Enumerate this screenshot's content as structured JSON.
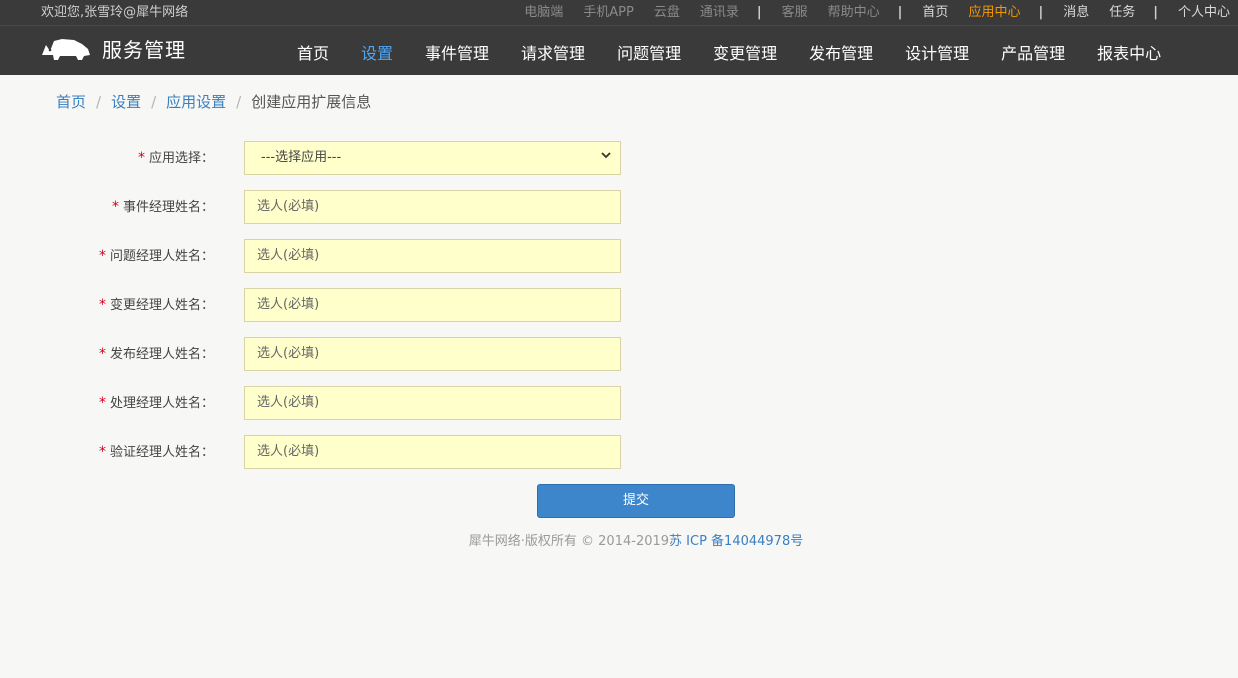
{
  "topbar": {
    "welcome": "欢迎您,张雪玲@犀牛网络",
    "links_dim": [
      "电脑端",
      "手机APP",
      "云盘",
      "通讯录"
    ],
    "links_help": [
      "客服",
      "帮助中心"
    ],
    "home": "首页",
    "app_center": "应用中心",
    "messages": "消息",
    "tasks": "任务",
    "personal_center": "个人中心",
    "separator": "|",
    "active_color": "#f39800"
  },
  "brand": {
    "logo_icon": "rhino-icon",
    "title": "服务管理"
  },
  "nav": {
    "items": [
      "首页",
      "设置",
      "事件管理",
      "请求管理",
      "问题管理",
      "变更管理",
      "发布管理",
      "设计管理",
      "产品管理",
      "报表中心"
    ],
    "active": "设置",
    "active_color": "#4fa6f0"
  },
  "breadcrumb": {
    "items": [
      "首页",
      "设置",
      "应用设置"
    ],
    "current": "创建应用扩展信息",
    "separator": "/"
  },
  "form": {
    "required_mark": "*",
    "app_select": {
      "label": "应用选择：",
      "value": "---选择应用---"
    },
    "fields": [
      {
        "label": "事件经理姓名：",
        "placeholder": "选人(必填)"
      },
      {
        "label": "问题经理人姓名：",
        "placeholder": "选人(必填)"
      },
      {
        "label": "变更经理人姓名：",
        "placeholder": "选人(必填)"
      },
      {
        "label": "发布经理人姓名：",
        "placeholder": "选人(必填)"
      },
      {
        "label": "处理经理人姓名：",
        "placeholder": "选人(必填)"
      },
      {
        "label": "验证经理人姓名：",
        "placeholder": "选人(必填)"
      }
    ],
    "field_background": "#ffffcc",
    "submit_label": "提交",
    "submit_color": "#3d86cc"
  },
  "footer": {
    "copyright": "犀牛网络·版权所有 © 2014-2019",
    "icp": "苏 ICP 备14044978号"
  }
}
